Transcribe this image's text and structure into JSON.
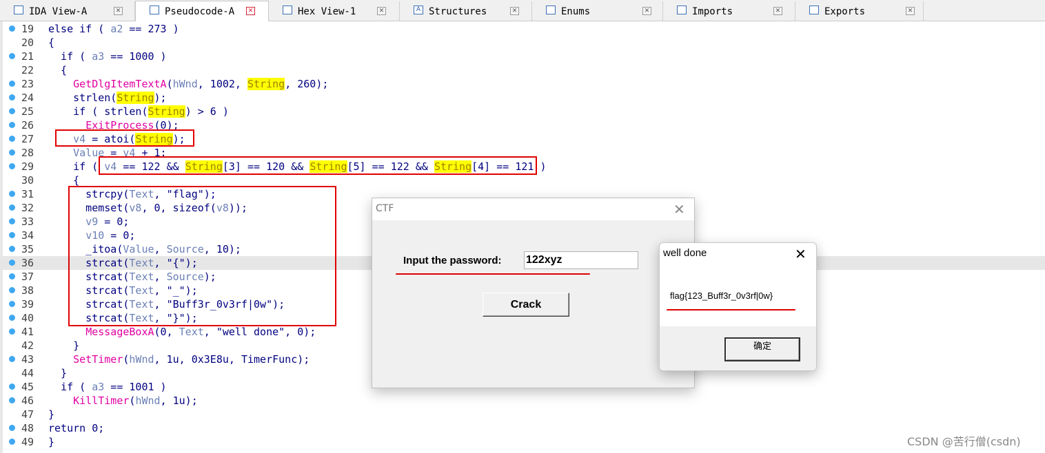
{
  "tabs": [
    {
      "label": "IDA View-A",
      "icon": "ida-view-icon",
      "active": false
    },
    {
      "label": "Pseudocode-A",
      "icon": "pseudocode-icon",
      "active": true
    },
    {
      "label": "Hex View-1",
      "icon": "hex-view-icon",
      "active": false
    },
    {
      "label": "Structures",
      "icon": "structures-icon",
      "glyph": "A",
      "active": false
    },
    {
      "label": "Enums",
      "icon": "enums-icon",
      "active": false
    },
    {
      "label": "Imports",
      "icon": "imports-icon",
      "active": false
    },
    {
      "label": "Exports",
      "icon": "exports-icon",
      "active": false
    }
  ],
  "code_lines": [
    {
      "n": "19",
      "dot": true,
      "html": "else if ( <span class='v'>a2</span> == 273 )"
    },
    {
      "n": "20",
      "dot": false,
      "html": "{"
    },
    {
      "n": "21",
      "dot": true,
      "html": "  if ( <span class='v'>a3</span> == 1000 )"
    },
    {
      "n": "22",
      "dot": false,
      "html": "  {"
    },
    {
      "n": "23",
      "dot": true,
      "html": "    <span class='f'>GetDlgItemTextA</span>(<span class='v'>hWnd</span>, 1002, <span class='y'>String</span>, 260);"
    },
    {
      "n": "24",
      "dot": true,
      "html": "    strlen(<span class='y'>String</span>);"
    },
    {
      "n": "25",
      "dot": true,
      "html": "    if ( strlen(<span class='y'>String</span>) > 6 )"
    },
    {
      "n": "26",
      "dot": true,
      "html": "      <span class='f'>ExitProcess</span>(0);"
    },
    {
      "n": "27",
      "dot": true,
      "html": "    <span class='v'>v4</span> = atoi(<span class='y'>String</span>);"
    },
    {
      "n": "28",
      "dot": true,
      "html": "    <span class='v'>Value</span> = <span class='v'>v4</span> + 1;"
    },
    {
      "n": "29",
      "dot": true,
      "html": "    if ( <span class='v'>v4</span> == 122 && <span class='y'>String</span>[3] == 120 && <span class='y'>String</span>[5] == 122 && <span class='y'>String</span>[4] == 121 )"
    },
    {
      "n": "30",
      "dot": false,
      "html": "    {"
    },
    {
      "n": "31",
      "dot": true,
      "html": "      strcpy(<span class='v'>Text</span>, \"flag\");"
    },
    {
      "n": "32",
      "dot": true,
      "html": "      memset(<span class='v'>v8</span>, 0, sizeof(<span class='v'>v8</span>));"
    },
    {
      "n": "33",
      "dot": true,
      "html": "      <span class='v'>v9</span> = 0;"
    },
    {
      "n": "34",
      "dot": true,
      "html": "      <span class='v'>v10</span> = 0;"
    },
    {
      "n": "35",
      "dot": true,
      "html": "      _itoa(<span class='v'>Value</span>, <span class='v'>Source</span>, 10);"
    },
    {
      "n": "36",
      "dot": true,
      "html": "      strcat(<span class='v'>Text</span>, \"{\");"
    },
    {
      "n": "37",
      "dot": true,
      "html": "      strcat(<span class='v'>Text</span>, <span class='v'>Source</span>);"
    },
    {
      "n": "38",
      "dot": true,
      "html": "      strcat(<span class='v'>Text</span>, \"_\");"
    },
    {
      "n": "39",
      "dot": true,
      "html": "      strcat(<span class='v'>Text</span>, \"Buff3r_0v3rf|0w\");"
    },
    {
      "n": "40",
      "dot": true,
      "html": "      strcat(<span class='v'>Text</span>, \"}\");"
    },
    {
      "n": "41",
      "dot": true,
      "html": "      <span class='f'>MessageBoxA</span>(0, <span class='v'>Text</span>, \"well done\", 0);"
    },
    {
      "n": "42",
      "dot": false,
      "html": "    }"
    },
    {
      "n": "43",
      "dot": true,
      "html": "    <span class='f'>SetTimer</span>(<span class='v'>hWnd</span>, 1u, 0x3E8u, TimerFunc);"
    },
    {
      "n": "44",
      "dot": false,
      "html": "  }"
    },
    {
      "n": "45",
      "dot": true,
      "html": "  if ( <span class='v'>a3</span> == 1001 )"
    },
    {
      "n": "46",
      "dot": true,
      "html": "    <span class='f'>KillTimer</span>(<span class='v'>hWnd</span>, 1u);"
    },
    {
      "n": "47",
      "dot": false,
      "html": "}"
    },
    {
      "n": "48",
      "dot": true,
      "html": "return 0;"
    },
    {
      "n": "49",
      "dot": true,
      "html": "}"
    }
  ],
  "ctf_dialog": {
    "title": "CTF",
    "prompt_label": "Input the password:",
    "password_value": "122xyz",
    "crack_button": "Crack"
  },
  "msgbox": {
    "title": "well done",
    "message": "flag{123_Buff3r_0v3rf|0w}",
    "ok_button": "确定"
  },
  "watermark": "CSDN @苦行僧(csdn)",
  "colors": {
    "keyword": "#000080",
    "variable": "#6a7fb5",
    "function": "#e000a0",
    "highlight": "#ffff00",
    "annotation_red": "#e00000",
    "breakpoint_dot": "#40a8f0"
  }
}
